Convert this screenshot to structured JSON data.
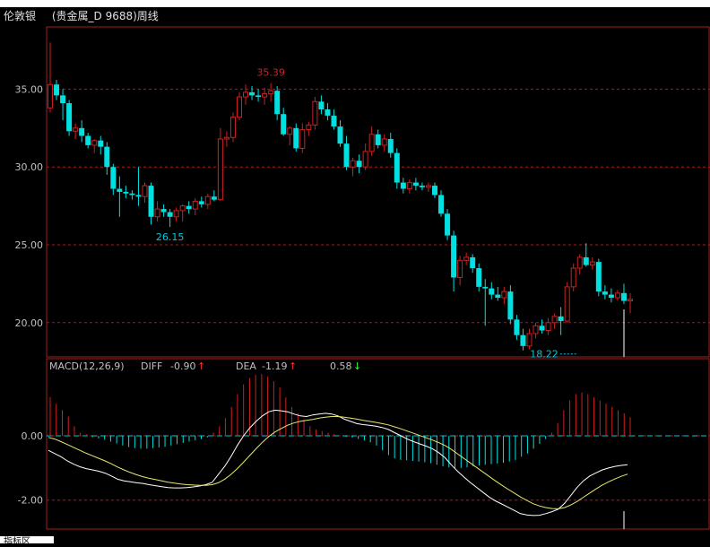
{
  "header": {
    "symbol": "伦敦银",
    "name": "(贵金属_D 9688)周线"
  },
  "macd_legend": {
    "label": "MACD(12,26,9)",
    "diff_label": "DIFF",
    "diff_value": "-0.90",
    "dea_label": "DEA",
    "dea_value": "-1.19",
    "macd_value": "0.58",
    "up_arrow": "↑",
    "down_arrow": "↓"
  },
  "tab": {
    "label": "指标区"
  },
  "colors": {
    "up": "#d02020",
    "down": "#00e0e0",
    "grid": "#a02020",
    "diff_line": "#ffffff",
    "dea_line": "#e8e870",
    "axis_text": "#c0c0c0",
    "annotation_high": "#d02020",
    "annotation_low": "#00c8e0",
    "legend_up": "#ff3030",
    "legend_down": "#30ff30"
  },
  "chart_data": [
    {
      "type": "candlestick",
      "title": "",
      "y_ticks": [
        "35.00",
        "30.00",
        "25.00",
        "20.00"
      ],
      "ylim": [
        17.8,
        39.0
      ],
      "annotations": [
        {
          "text": "35.39",
          "value": 35.39,
          "kind": "high",
          "index": 35
        },
        {
          "text": "26.15",
          "value": 26.15,
          "kind": "low",
          "index": 19
        },
        {
          "text": "18.22",
          "value": 18.22,
          "kind": "low",
          "index": 84
        }
      ],
      "ohlc": [
        [
          33.8,
          38.0,
          33.5,
          35.3
        ],
        [
          35.3,
          35.6,
          34.3,
          34.6
        ],
        [
          34.6,
          35.0,
          33.0,
          34.1
        ],
        [
          34.1,
          34.3,
          32.0,
          32.3
        ],
        [
          32.3,
          32.8,
          31.8,
          32.5
        ],
        [
          32.5,
          33.0,
          31.6,
          32.0
        ],
        [
          32.0,
          32.2,
          31.2,
          31.4
        ],
        [
          31.4,
          31.8,
          30.9,
          31.7
        ],
        [
          31.7,
          32.0,
          30.8,
          31.3
        ],
        [
          31.3,
          31.6,
          29.5,
          30.0
        ],
        [
          30.0,
          30.2,
          28.2,
          28.6
        ],
        [
          28.6,
          29.4,
          26.8,
          28.4
        ],
        [
          28.4,
          28.8,
          28.0,
          28.3
        ],
        [
          28.3,
          28.5,
          27.9,
          28.2
        ],
        [
          28.2,
          30.0,
          27.5,
          28.1
        ],
        [
          28.1,
          29.0,
          27.7,
          28.8
        ],
        [
          28.8,
          29.0,
          26.3,
          26.8
        ],
        [
          26.8,
          27.8,
          26.5,
          27.3
        ],
        [
          27.3,
          27.6,
          26.8,
          27.1
        ],
        [
          27.1,
          27.3,
          26.15,
          26.8
        ],
        [
          26.8,
          27.4,
          26.5,
          27.2
        ],
        [
          27.2,
          27.6,
          26.5,
          27.5
        ],
        [
          27.5,
          27.8,
          27.0,
          27.3
        ],
        [
          27.3,
          28.0,
          26.9,
          27.8
        ],
        [
          27.8,
          28.1,
          27.4,
          27.6
        ],
        [
          27.6,
          28.3,
          27.3,
          28.1
        ],
        [
          28.1,
          28.5,
          27.8,
          27.9
        ],
        [
          27.9,
          32.5,
          27.8,
          31.8
        ],
        [
          31.8,
          32.3,
          31.3,
          31.9
        ],
        [
          31.9,
          33.5,
          31.6,
          33.2
        ],
        [
          33.2,
          34.8,
          33.0,
          34.5
        ],
        [
          34.5,
          35.3,
          34.0,
          34.8
        ],
        [
          34.8,
          35.2,
          34.3,
          34.6
        ],
        [
          34.6,
          35.0,
          34.2,
          34.5
        ],
        [
          34.5,
          35.1,
          34.0,
          34.7
        ],
        [
          34.7,
          35.39,
          34.2,
          34.9
        ],
        [
          34.9,
          35.2,
          33.0,
          33.4
        ],
        [
          33.4,
          33.8,
          32.0,
          32.1
        ],
        [
          32.1,
          32.6,
          31.4,
          32.5
        ],
        [
          32.5,
          32.8,
          31.0,
          31.2
        ],
        [
          31.2,
          32.8,
          30.9,
          32.4
        ],
        [
          32.4,
          32.9,
          32.0,
          32.7
        ],
        [
          32.7,
          34.5,
          32.4,
          34.2
        ],
        [
          34.2,
          34.6,
          33.4,
          33.7
        ],
        [
          33.7,
          34.1,
          33.0,
          33.3
        ],
        [
          33.3,
          33.7,
          32.4,
          32.6
        ],
        [
          32.6,
          33.0,
          31.3,
          31.5
        ],
        [
          31.5,
          32.0,
          29.8,
          30.0
        ],
        [
          30.0,
          30.6,
          29.4,
          30.4
        ],
        [
          30.4,
          30.8,
          29.6,
          30.0
        ],
        [
          30.0,
          31.5,
          29.8,
          31.0
        ],
        [
          31.0,
          32.6,
          30.7,
          32.1
        ],
        [
          32.1,
          32.4,
          31.2,
          31.4
        ],
        [
          31.4,
          32.1,
          31.0,
          31.8
        ],
        [
          31.8,
          32.2,
          30.6,
          30.9
        ],
        [
          30.9,
          31.2,
          28.6,
          29.0
        ],
        [
          29.0,
          29.3,
          28.3,
          28.6
        ],
        [
          28.6,
          29.2,
          28.3,
          29.0
        ],
        [
          29.0,
          29.3,
          28.5,
          28.8
        ],
        [
          28.8,
          29.0,
          28.5,
          28.7
        ],
        [
          28.7,
          29.0,
          28.4,
          28.8
        ],
        [
          28.8,
          29.0,
          28.0,
          28.2
        ],
        [
          28.2,
          28.5,
          26.8,
          27.0
        ],
        [
          27.0,
          27.3,
          25.3,
          25.6
        ],
        [
          25.6,
          25.9,
          22.0,
          22.9
        ],
        [
          22.9,
          24.3,
          22.4,
          24.0
        ],
        [
          24.0,
          24.5,
          23.7,
          24.2
        ],
        [
          24.2,
          24.4,
          23.2,
          23.5
        ],
        [
          23.5,
          23.8,
          22.0,
          22.3
        ],
        [
          22.3,
          22.8,
          19.8,
          22.2
        ],
        [
          22.2,
          22.6,
          21.5,
          21.8
        ],
        [
          21.8,
          22.3,
          21.4,
          21.6
        ],
        [
          21.6,
          22.3,
          21.2,
          22.0
        ],
        [
          22.0,
          22.4,
          19.9,
          20.2
        ],
        [
          20.2,
          20.5,
          18.9,
          19.2
        ],
        [
          19.2,
          19.6,
          18.22,
          18.5
        ],
        [
          18.5,
          19.6,
          18.3,
          19.3
        ],
        [
          19.3,
          20.0,
          19.0,
          19.8
        ],
        [
          19.8,
          20.2,
          19.3,
          19.5
        ],
        [
          19.5,
          20.3,
          19.2,
          20.0
        ],
        [
          20.0,
          20.6,
          19.6,
          20.4
        ],
        [
          20.4,
          21.0,
          19.2,
          20.1
        ],
        [
          20.1,
          22.6,
          20.0,
          22.3
        ],
        [
          22.3,
          23.8,
          22.0,
          23.5
        ],
        [
          23.5,
          24.4,
          23.1,
          24.2
        ],
        [
          24.2,
          25.1,
          23.6,
          23.7
        ],
        [
          23.7,
          24.2,
          23.4,
          23.9
        ],
        [
          23.9,
          24.1,
          21.7,
          22.0
        ],
        [
          22.0,
          22.4,
          21.5,
          21.8
        ],
        [
          21.8,
          22.2,
          21.3,
          21.6
        ],
        [
          21.6,
          22.1,
          21.4,
          21.9
        ],
        [
          21.9,
          22.5,
          21.2,
          21.4
        ],
        [
          21.4,
          21.9,
          20.6,
          21.5
        ]
      ]
    },
    {
      "type": "bar+line",
      "title": "",
      "y_ticks": [
        "0.00",
        "-2.00"
      ],
      "ylim": [
        -2.9,
        2.4
      ],
      "series": [
        {
          "name": "DIFF",
          "values": [
            -0.45,
            -0.55,
            -0.65,
            -0.78,
            -0.88,
            -0.96,
            -1.02,
            -1.06,
            -1.1,
            -1.16,
            -1.25,
            -1.35,
            -1.4,
            -1.43,
            -1.46,
            -1.48,
            -1.52,
            -1.55,
            -1.58,
            -1.61,
            -1.62,
            -1.62,
            -1.61,
            -1.59,
            -1.56,
            -1.52,
            -1.45,
            -1.2,
            -0.95,
            -0.65,
            -0.3,
            0.0,
            0.25,
            0.45,
            0.62,
            0.75,
            0.8,
            0.78,
            0.75,
            0.68,
            0.62,
            0.6,
            0.65,
            0.68,
            0.7,
            0.68,
            0.62,
            0.52,
            0.45,
            0.38,
            0.35,
            0.33,
            0.3,
            0.26,
            0.2,
            0.1,
            0.0,
            -0.1,
            -0.18,
            -0.25,
            -0.32,
            -0.4,
            -0.52,
            -0.68,
            -0.9,
            -1.1,
            -1.28,
            -1.45,
            -1.6,
            -1.75,
            -1.9,
            -2.02,
            -2.12,
            -2.22,
            -2.32,
            -2.42,
            -2.46,
            -2.48,
            -2.47,
            -2.42,
            -2.36,
            -2.28,
            -2.1,
            -1.85,
            -1.6,
            -1.4,
            -1.25,
            -1.15,
            -1.06,
            -1.0,
            -0.95,
            -0.92,
            -0.9
          ]
        },
        {
          "name": "DEA",
          "values": [
            -0.05,
            -0.1,
            -0.18,
            -0.27,
            -0.36,
            -0.45,
            -0.54,
            -0.62,
            -0.7,
            -0.78,
            -0.87,
            -0.97,
            -1.06,
            -1.14,
            -1.21,
            -1.27,
            -1.32,
            -1.36,
            -1.4,
            -1.44,
            -1.47,
            -1.5,
            -1.52,
            -1.53,
            -1.54,
            -1.54,
            -1.52,
            -1.46,
            -1.35,
            -1.2,
            -1.02,
            -0.82,
            -0.61,
            -0.4,
            -0.2,
            -0.02,
            0.12,
            0.23,
            0.33,
            0.4,
            0.45,
            0.48,
            0.51,
            0.55,
            0.58,
            0.6,
            0.6,
            0.58,
            0.55,
            0.52,
            0.48,
            0.45,
            0.42,
            0.38,
            0.34,
            0.28,
            0.22,
            0.15,
            0.08,
            0.01,
            -0.06,
            -0.13,
            -0.21,
            -0.3,
            -0.42,
            -0.56,
            -0.7,
            -0.84,
            -0.98,
            -1.12,
            -1.26,
            -1.4,
            -1.53,
            -1.66,
            -1.78,
            -1.9,
            -2.01,
            -2.11,
            -2.18,
            -2.23,
            -2.26,
            -2.27,
            -2.23,
            -2.15,
            -2.04,
            -1.91,
            -1.78,
            -1.65,
            -1.53,
            -1.43,
            -1.34,
            -1.26,
            -1.19
          ]
        },
        {
          "name": "MACD",
          "values": [
            1.2,
            1.0,
            0.8,
            0.6,
            0.3,
            0.1,
            0.05,
            -0.04,
            -0.08,
            -0.12,
            -0.18,
            -0.24,
            -0.3,
            -0.35,
            -0.38,
            -0.4,
            -0.4,
            -0.38,
            -0.36,
            -0.34,
            -0.3,
            -0.26,
            -0.22,
            -0.18,
            -0.14,
            -0.1,
            -0.05,
            0.1,
            0.3,
            0.55,
            0.9,
            1.3,
            1.6,
            1.8,
            1.9,
            1.92,
            1.85,
            1.7,
            1.5,
            1.2,
            0.9,
            0.7,
            0.5,
            0.3,
            0.2,
            0.15,
            0.1,
            0.06,
            0.02,
            -0.03,
            -0.06,
            -0.1,
            -0.14,
            -0.2,
            -0.3,
            -0.45,
            -0.6,
            -0.7,
            -0.75,
            -0.76,
            -0.78,
            -0.8,
            -0.82,
            -0.85,
            -0.9,
            -0.95,
            -0.98,
            -1.0,
            -1.0,
            -0.98,
            -0.95,
            -0.92,
            -0.9,
            -0.88,
            -0.86,
            -0.84,
            -0.8,
            -0.75,
            -0.65,
            -0.55,
            -0.4,
            -0.25,
            -0.1,
            0.1,
            0.4,
            0.8,
            1.1,
            1.3,
            1.35,
            1.3,
            1.2,
            1.1,
            1.0,
            0.9,
            0.8,
            0.7,
            0.58
          ]
        }
      ]
    }
  ]
}
